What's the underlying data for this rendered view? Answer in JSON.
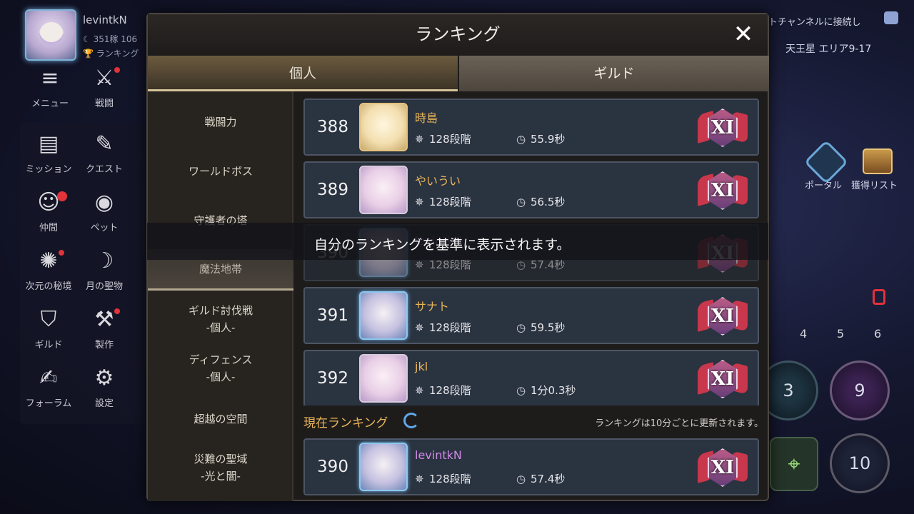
{
  "player": {
    "name": "levintkN",
    "sub1": "☾ 351稼 106",
    "sub2": "🏆 ランキング"
  },
  "hud_menu": [
    {
      "label": "メニュー",
      "icon": "≡"
    },
    {
      "label": "戦闘",
      "icon": "⚔"
    },
    {
      "label": "ミッション",
      "icon": "▤"
    },
    {
      "label": "クエスト",
      "icon": "✎"
    },
    {
      "label": "仲間",
      "icon": "☺"
    },
    {
      "label": "ペット",
      "icon": "◉"
    },
    {
      "label": "次元の秘境",
      "icon": "✺"
    },
    {
      "label": "月の聖物",
      "icon": "☽"
    },
    {
      "label": "ギルド",
      "icon": "⛉"
    },
    {
      "label": "製作",
      "icon": "⚒"
    },
    {
      "label": "フォーラム",
      "icon": "✍"
    },
    {
      "label": "設定",
      "icon": "⚙"
    }
  ],
  "right_hud": {
    "channel_text": "トチャンネルに接続し",
    "location": "天王星 エリア9-17",
    "portal": "ポータル",
    "loot_list": "獲得リスト",
    "nums": [
      "4",
      "5",
      "6"
    ],
    "skill_a": "3",
    "skill_b": "9",
    "skill_c": "10"
  },
  "modal": {
    "title": "ランキング",
    "close": "✕",
    "tabs": {
      "personal": "個人",
      "guild": "ギルド"
    },
    "sidebar": [
      "戦闘力",
      "ワールドボス",
      "守護者の塔",
      "魔法地帯",
      "ギルド討伐戦\n-個人-",
      "ディフェンス\n-個人-",
      "超越の空間",
      "災難の聖域\n-光と闇-"
    ],
    "rows": [
      {
        "rank": "388",
        "name": "時島",
        "stage": "128段階",
        "time": "55.9秒",
        "badge": "XI"
      },
      {
        "rank": "389",
        "name": "やいうい",
        "stage": "128段階",
        "time": "56.5秒",
        "badge": "XI"
      },
      {
        "rank": "390",
        "name": "levintkN",
        "stage": "128段階",
        "time": "57.4秒",
        "badge": "XI"
      },
      {
        "rank": "391",
        "name": "サナト",
        "stage": "128段階",
        "time": "59.5秒",
        "badge": "XI"
      },
      {
        "rank": "392",
        "name": "jkl",
        "stage": "128段階",
        "time": "1分0.3秒",
        "badge": "XI"
      }
    ],
    "toast": "自分のランキングを基準に表示されます。",
    "current_label": "現在ランキング",
    "update_note": "ランキングは10分ごとに更新されます。",
    "my_row": {
      "rank": "390",
      "name": "levintkN",
      "stage": "128段階",
      "time": "57.4秒",
      "badge": "XI"
    }
  },
  "colors": {
    "name_gold": "#e9b65a",
    "name_me": "#d08ae6",
    "row_bg": "#2a3340",
    "accent_blue": "#5fa8e8"
  }
}
